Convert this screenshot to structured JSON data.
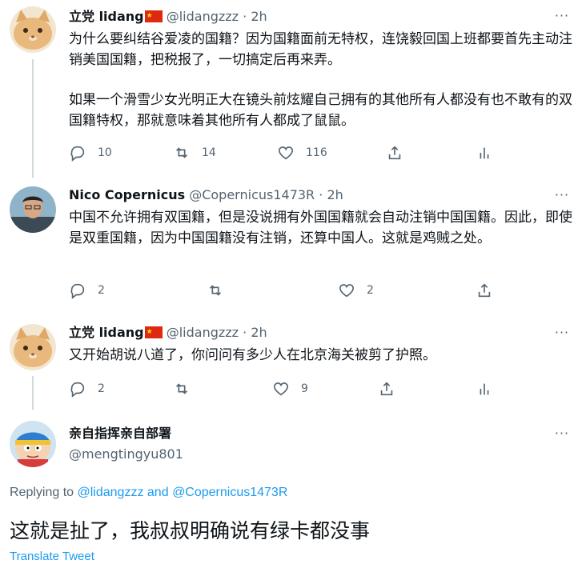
{
  "tweets": [
    {
      "name": "立党 lidang",
      "handle": "@lidangzzz",
      "time": "· 2h",
      "text1": "为什么要纠结谷爱凌的国籍？因为国籍面前无特权，连饶毅回国上班都要首先主动注销美国国籍，把税报了，一切搞定后再来弄。",
      "text2": "如果一个滑雪少女光明正大在镜头前炫耀自己拥有的其他所有人都没有也不敢有的双国籍特权，那就意味着其他所有人都成了鼠鼠。",
      "replies": "10",
      "retweets": "14",
      "likes": "116"
    },
    {
      "name": "Nico Copernicus",
      "handle": "@Copernicus1473R",
      "time": "· 2h",
      "text1": "中国不允许拥有双国籍，但是没说拥有外国国籍就会自动注销中国国籍。因此，即使是双重国籍，因为中国国籍没有注销，还算中国人。这就是鸡贼之处。",
      "replies": "2",
      "retweets": "",
      "likes": "2"
    },
    {
      "name": "立党 lidang",
      "handle": "@lidangzzz",
      "time": "· 2h",
      "text1": "又开始胡说八道了，你问问有多少人在北京海关被剪了护照。",
      "replies": "2",
      "retweets": "",
      "likes": "9"
    }
  ],
  "main": {
    "name": "亲自指挥亲自部署",
    "handle": "@mengtingyu801",
    "replying_prefix": "Replying to",
    "reply_user1": "@lidangzzz",
    "reply_and": "and",
    "reply_user2": "@Copernicus1473R",
    "text": "这就是扯了，我叔叔明确说有绿卡都没事",
    "translate": "Translate Tweet"
  },
  "icons": {
    "more": "more-horizontal-icon",
    "reply": "reply-icon",
    "retweet": "retweet-icon",
    "like": "heart-icon",
    "share": "share-icon",
    "analytics": "analytics-icon"
  },
  "colors": {
    "link": "#1d9bf0",
    "secondary": "#536471",
    "thread_line": "#cfd9de"
  }
}
